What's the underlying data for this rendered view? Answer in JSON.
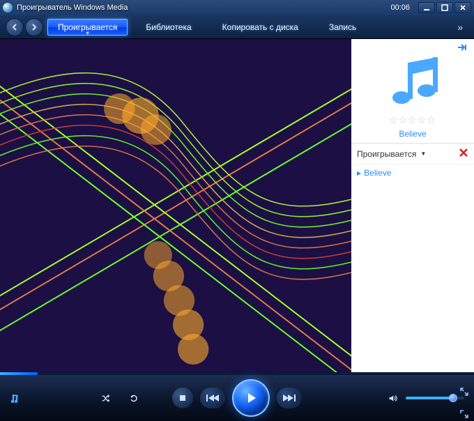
{
  "titlebar": {
    "title": "Проигрыватель Windows Media",
    "time": "00:06"
  },
  "tabs": {
    "now_playing": "Проигрывается",
    "library": "Библиотека",
    "rip": "Копировать с диска",
    "burn": "Запись"
  },
  "sidebar": {
    "track_title": "Believe",
    "playlist_label": "Проигрывается",
    "items": [
      "Believe"
    ]
  },
  "playback": {
    "position_seconds": 6,
    "volume_percent": 75
  }
}
